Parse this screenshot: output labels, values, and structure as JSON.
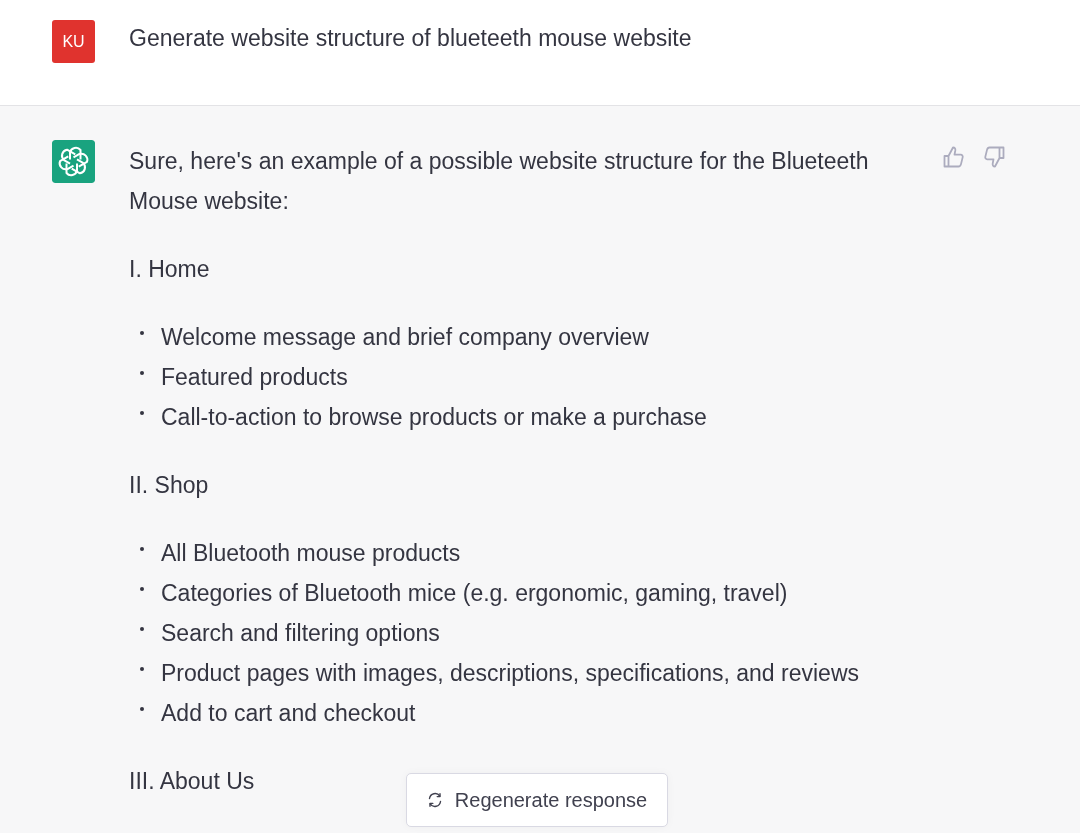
{
  "user_message": {
    "avatar": "KU",
    "text": "Generate website structure of blueteeth mouse website"
  },
  "assistant_message": {
    "blocks": [
      {
        "kind": "paragraph",
        "text": "Sure, here's an example of a possible website structure for the Blueteeth Mouse website:"
      },
      {
        "kind": "paragraph",
        "text": "I. Home"
      },
      {
        "kind": "list",
        "items": [
          "Welcome message and brief company overview",
          "Featured products",
          "Call-to-action to browse products or make a purchase"
        ]
      },
      {
        "kind": "paragraph",
        "text": "II. Shop"
      },
      {
        "kind": "list",
        "items": [
          "All Bluetooth mouse products",
          "Categories of Bluetooth mice (e.g. ergonomic, gaming, travel)",
          "Search and filtering options",
          "Product pages with images, descriptions, specifications, and reviews",
          "Add to cart and checkout"
        ]
      },
      {
        "kind": "paragraph",
        "text": "III. About Us"
      }
    ]
  },
  "regenerate_button": {
    "label": "Regenerate response"
  }
}
